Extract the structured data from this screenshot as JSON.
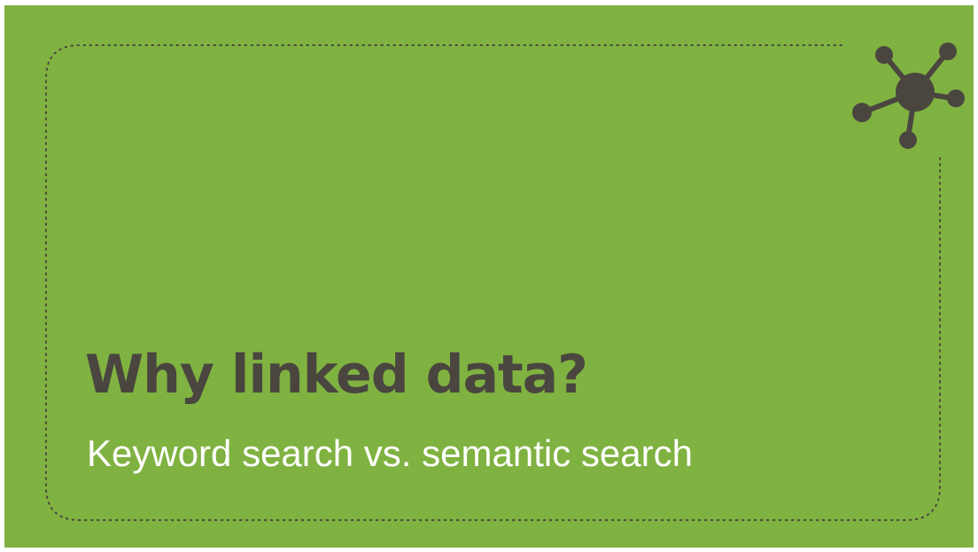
{
  "slide": {
    "title": "Why linked data?",
    "subtitle": "Keyword search vs. semantic search",
    "icon": "linked-data-network-icon",
    "colors": {
      "background": "#7fb241",
      "title": "#4a463f",
      "subtitle": "#ffffff",
      "border": "#4a463f"
    }
  }
}
